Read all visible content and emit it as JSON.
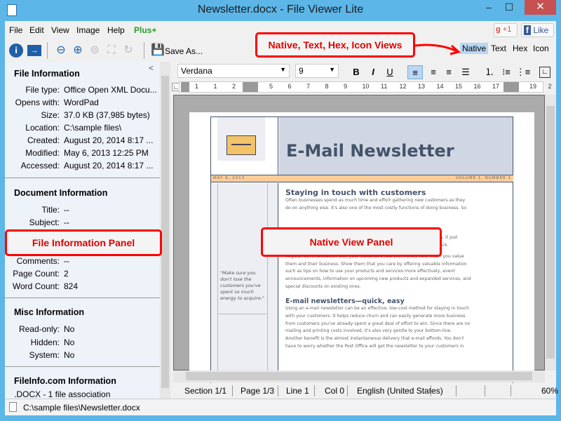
{
  "window": {
    "title": "Newsletter.docx - File Viewer Lite",
    "minimize": "–",
    "maximize": "☐",
    "close": "✕"
  },
  "menu": [
    "File",
    "Edit",
    "View",
    "Image",
    "Help",
    "Plus+"
  ],
  "toolbar": {
    "save_as": "Save As..."
  },
  "social": {
    "gplus": "+1",
    "fb_like": "Like"
  },
  "view_tabs": [
    "Native",
    "Text",
    "Hex",
    "Icon"
  ],
  "active_view": "Native",
  "annotations": {
    "views": "Native, Text, Hex, Icon Views",
    "file_panel": "File Information Panel",
    "native_panel": "Native View Panel"
  },
  "left_panel": {
    "collapse": "<",
    "file_info": {
      "title": "File Information",
      "rows": [
        {
          "label": "File type:",
          "value": "Office Open XML Docu..."
        },
        {
          "label": "Opens with:",
          "value": "WordPad"
        },
        {
          "label": "Size:",
          "value": "37.0 KB (37,985 bytes)"
        },
        {
          "label": "Location:",
          "value": "C:\\sample files\\"
        },
        {
          "label": "Created:",
          "value": "August 20, 2014 8:17 ..."
        },
        {
          "label": "Modified:",
          "value": "May 6, 2013 12:25 PM"
        },
        {
          "label": "Accessed:",
          "value": "August 20, 2014 8:17 ..."
        }
      ]
    },
    "doc_info": {
      "title": "Document Information",
      "rows": [
        {
          "label": "Title:",
          "value": "--"
        },
        {
          "label": "Subject:",
          "value": "--"
        },
        {
          "label": "Comments:",
          "value": "--"
        },
        {
          "label": "Page Count:",
          "value": "2"
        },
        {
          "label": "Word Count:",
          "value": "824"
        }
      ]
    },
    "misc_info": {
      "title": "Misc Information",
      "rows": [
        {
          "label": "Read-only:",
          "value": "No"
        },
        {
          "label": "Hidden:",
          "value": "No"
        },
        {
          "label": "System:",
          "value": "No"
        }
      ]
    },
    "fileinfo": {
      "title": "FileInfo.com Information",
      "line": ".DOCX - 1 file association"
    }
  },
  "format": {
    "font": "Verdana",
    "size": "9",
    "bold": "B",
    "italic": "I",
    "underline": "U"
  },
  "ruler": [
    "1",
    "1",
    "2",
    "3",
    "5",
    "6",
    "7",
    "8",
    "9",
    "10",
    "11",
    "12",
    "13",
    "14",
    "15",
    "16",
    "17",
    "18",
    "19",
    "2"
  ],
  "document": {
    "title": "E-Mail Newsletter",
    "date": "MAY 6, 2013",
    "volume": "VOLUME 1, NUMBER 1",
    "h1": "Staying in touch with customers",
    "p1": [
      "Often businesses spend as much time and effort gathering new customers as they",
      "do on anything else. It's also one of the most costly functions of doing business. So",
      "",
      "",
      "",
      "much less to keep existing customers than to constantly replacing them, it just",
      "makes good business sense to do what it takes to keep them coming back."
    ],
    "p2": [
      "Regular communication with your customers lets them know how much you value",
      "them and their business. Show them that you care by offering valuable information",
      "such as tips on how to use your products and services more effectively, event",
      "announcements, information on upcoming new products and expanded services, and",
      "special discounts on existing ones."
    ],
    "h2": "E-mail newsletters—quick, easy",
    "p3": [
      "Using an e-mail newsletter can be an effective, low-cost method for staying in touch",
      "with your customers. It helps reduce churn and can easily generate more business",
      "from customers you've already spent a great deal of effort to win. Since there are no",
      "mailing and printing costs involved, it's also very gentle to your bottom-line.",
      "Another benefit is the almost instantaneous delivery that e-mail affords. You don't",
      "have to worry whether the Post Office will get the newsletter to your customers in"
    ],
    "quote": "\"Make sure you don't lose the customers you've spent so much energy to acquire.\""
  },
  "status": {
    "section": "Section 1/1",
    "page": "Page 1/3",
    "line": "Line 1",
    "col": "Col 0",
    "language": "English (United States)",
    "zoom": "60%"
  },
  "path": "C:\\sample files\\Newsletter.docx",
  "colors": {
    "frame": "#5cb6e8",
    "close": "#c75050",
    "annotation": "#ff0000",
    "banner": "#ffcc99",
    "header_bg": "#d0d6e2",
    "plus": "#2c9a2c"
  }
}
